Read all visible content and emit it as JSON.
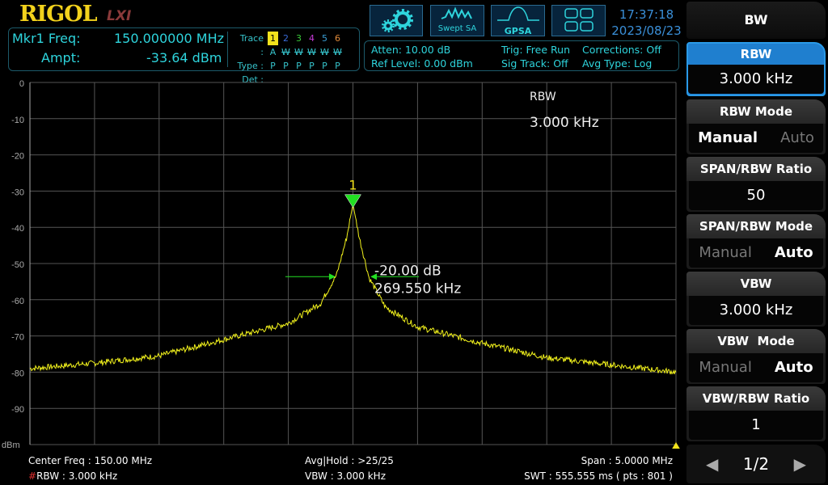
{
  "header": {
    "brand": "RIGOL",
    "lxi": "LXI",
    "time": "17:37:18",
    "date": "2023/08/23",
    "mode_buttons": [
      {
        "icon": "gear-icon"
      },
      {
        "icon": "swept-sa-icon",
        "label": "Swept SA"
      },
      {
        "icon": "gpsa-icon",
        "label": "GPSA"
      },
      {
        "icon": "layout-grid-icon"
      }
    ]
  },
  "marker": {
    "freq_label": "Mkr1 Freq:",
    "freq_value": "150.000000 MHz",
    "ampt_label": "Ampt:",
    "ampt_value": "-33.64 dBm"
  },
  "trace": {
    "trace_label": "Trace :",
    "type_label": "Type :",
    "det_label": "Det :",
    "numbers": [
      "1",
      "2",
      "3",
      "4",
      "5",
      "6"
    ],
    "colors": [
      "#f2e21c",
      "#3a6ad8",
      "#3ac83a",
      "#c83ad8",
      "#3aa0d8",
      "#e08a3a"
    ],
    "types": [
      "A",
      "W",
      "W",
      "W",
      "W",
      "W"
    ],
    "dets": [
      "P",
      "P",
      "P",
      "P",
      "P",
      "P"
    ]
  },
  "info": {
    "atten": "Atten: 10.00 dB",
    "ref": "Ref Level: 0.00 dBm",
    "trig": "Trig: Free Run",
    "sigtrack": "Sig Track: Off",
    "corr": "Corrections: Off",
    "avgtype": "Avg Type: Log"
  },
  "plot": {
    "rbw_label": "RBW",
    "rbw_value": "3.000 kHz",
    "marker_num": "1",
    "ndb_value": "-20.00 dB",
    "ndb_bw": "269.550 kHz",
    "unit": "dBm"
  },
  "footer": {
    "center": "Center Freq : 150.00 MHz",
    "rbw_hash": "#",
    "rbw": "RBW : 3.000 kHz",
    "avg": "Avg|Hold : >25/25",
    "vbw": "VBW : 3.000 kHz",
    "span": "Span : 5.0000 MHz",
    "swt": "SWT : 555.555 ms ( pts : 801 )"
  },
  "softkeys": {
    "title": "BW",
    "rbw_label": "RBW",
    "rbw_value": "3.000 kHz",
    "rbw_mode_label": "RBW Mode",
    "rbw_mode_opts": [
      "Manual",
      "Auto"
    ],
    "rbw_mode_sel": "Manual",
    "span_ratio_label": "SPAN/RBW Ratio",
    "span_ratio_value": "50",
    "span_mode_label": "SPAN/RBW Mode",
    "span_mode_opts": [
      "Manual",
      "Auto"
    ],
    "span_mode_sel": "Auto",
    "vbw_label": "VBW",
    "vbw_value": "3.000 kHz",
    "vbw_mode_label": "VBW  Mode",
    "vbw_mode_opts": [
      "Manual",
      "Auto"
    ],
    "vbw_mode_sel": "Auto",
    "vbw_ratio_label": "VBW/RBW Ratio",
    "vbw_ratio_value": "1",
    "page": "1/2"
  },
  "chart_data": {
    "type": "line",
    "xlabel": "",
    "ylabel": "dBm",
    "x_unit": "MHz",
    "xlim": [
      147.5,
      152.5
    ],
    "ylim": [
      -100,
      0
    ],
    "yticks": [
      "0",
      "-10",
      "-20",
      "-30",
      "-40",
      "-50",
      "-60",
      "-70",
      "-80",
      "-90"
    ],
    "grid": true,
    "trace_color": "#f2f21c",
    "x": [
      147.5,
      148.0,
      148.5,
      149.0,
      149.5,
      149.75,
      149.875,
      149.95,
      150.0,
      150.05,
      150.125,
      150.25,
      150.5,
      151.0,
      151.5,
      152.0,
      152.5
    ],
    "y": [
      -79,
      -77.5,
      -75.5,
      -71,
      -66.5,
      -61,
      -53,
      -43,
      -33.64,
      -43,
      -54,
      -62,
      -67.5,
      -72,
      -76,
      -78,
      -80
    ],
    "marker": {
      "x": 150.0,
      "y": -33.64
    },
    "ndb_x": [
      149.865,
      150.135
    ],
    "ndb_y": -53.64
  }
}
